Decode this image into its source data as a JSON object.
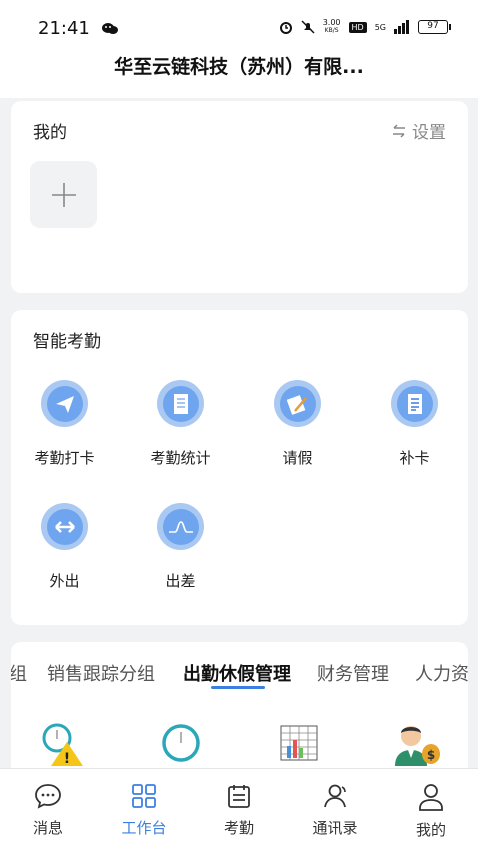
{
  "status_bar": {
    "time": "21:41",
    "speed_value": "3.00",
    "speed_unit": "KB/S",
    "hd": "HD",
    "network": "5G",
    "battery": "97"
  },
  "header": {
    "title": "华至云链科技（苏州）有限..."
  },
  "my_section": {
    "title": "我的",
    "settings_label": "设置",
    "add_icon": "plus-icon"
  },
  "attendance_section": {
    "title": "智能考勤",
    "apps": [
      {
        "label": "考勤打卡",
        "icon": "paper-plane-icon"
      },
      {
        "label": "考勤统计",
        "icon": "document-icon"
      },
      {
        "label": "请假",
        "icon": "edit-note-icon"
      },
      {
        "label": "补卡",
        "icon": "list-document-icon"
      },
      {
        "label": "外出",
        "icon": "double-arrow-icon"
      },
      {
        "label": "出差",
        "icon": "wave-icon"
      }
    ]
  },
  "groups_section": {
    "tabs": [
      {
        "label": "组"
      },
      {
        "label": "销售跟踪分组"
      },
      {
        "label": "出勤休假管理",
        "active": true
      },
      {
        "label": "财务管理"
      },
      {
        "label": "人力资"
      }
    ],
    "icons": [
      "clock-warning-icon",
      "clock-icon",
      "chart-table-icon",
      "money-person-icon"
    ]
  },
  "tab_bar": {
    "items": [
      {
        "label": "消息",
        "icon": "chat-bubble-icon"
      },
      {
        "label": "工作台",
        "icon": "grid-icon",
        "active": true
      },
      {
        "label": "考勤",
        "icon": "calendar-icon"
      },
      {
        "label": "通讯录",
        "icon": "contacts-icon"
      },
      {
        "label": "我的",
        "icon": "person-icon"
      }
    ]
  },
  "colors": {
    "accent": "#3c7fe0",
    "icon_bg": "#a9c8f2",
    "icon_fg": "#6fa4ee"
  }
}
